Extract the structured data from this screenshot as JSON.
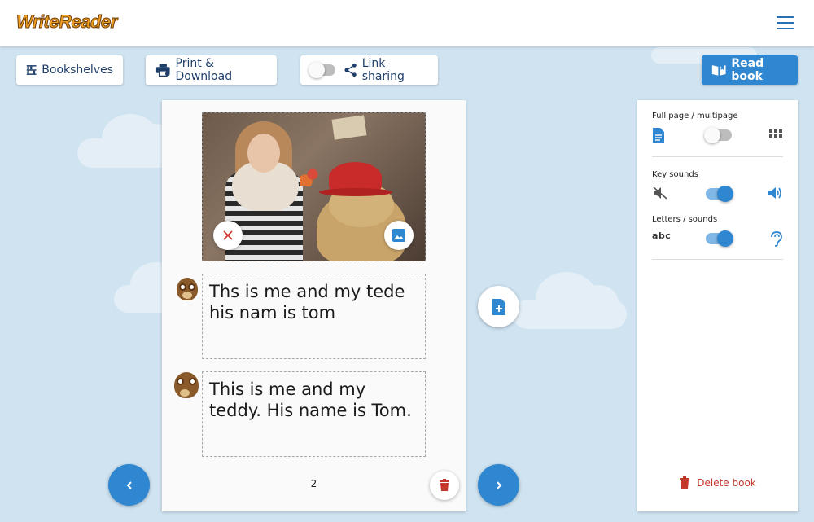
{
  "app": {
    "logo_text": "WriteReader",
    "brand_color": "#2f86d1"
  },
  "toolbar": {
    "bookshelves_label": "Bookshelves",
    "print_label": "Print & Download",
    "link_sharing_label": "Link sharing",
    "link_sharing_on": false,
    "read_book_label": "Read book"
  },
  "page": {
    "text_child": "Ths is me and my tede his nam is tom",
    "text_adult": "This is me and my teddy. His name is Tom.",
    "page_number": "2"
  },
  "settings": {
    "full_page_label": "Full page / multipage",
    "full_page_on": false,
    "key_sounds_label": "Key sounds",
    "key_sounds_on": true,
    "letters_sounds_label": "Letters / sounds",
    "letters_sounds_on": true,
    "letters_icon_text": "abc",
    "delete_book_label": "Delete book"
  }
}
